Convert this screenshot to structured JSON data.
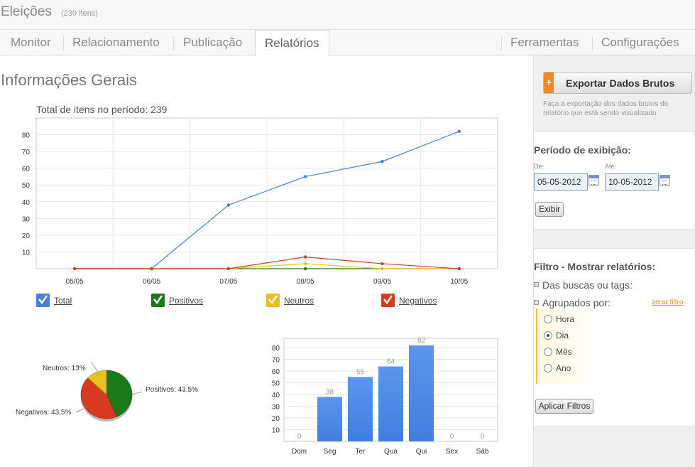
{
  "app": {
    "title": "Eleições",
    "item_count": "(239 itens)"
  },
  "tabs": [
    {
      "label": "Monitor",
      "active": false
    },
    {
      "label": "Relacionamento",
      "active": false
    },
    {
      "label": "Publicação",
      "active": false
    },
    {
      "label": "Relatórios",
      "active": true
    },
    {
      "label": "Ferramentas",
      "active": false
    },
    {
      "label": "Configurações",
      "active": false
    }
  ],
  "main": {
    "title": "Informações Gerais",
    "total_caption": "Total de itens no período: 239"
  },
  "colors": {
    "total": "#4a7fd4",
    "positivos": "#1a7a1a",
    "neutros": "#e8c020",
    "negativos": "#d83a20",
    "bars": "#3f7fe0"
  },
  "chart_data": [
    {
      "type": "line",
      "x": [
        "05/05",
        "06/05",
        "07/05",
        "08/05",
        "09/05",
        "10/05"
      ],
      "ylim": [
        0,
        90
      ],
      "yticks": [
        10,
        20,
        30,
        40,
        50,
        60,
        70,
        80
      ],
      "series": [
        {
          "name": "Total",
          "values": [
            0,
            0,
            38,
            55,
            64,
            82
          ]
        },
        {
          "name": "Positivos",
          "values": [
            0,
            0,
            0,
            0,
            0,
            0
          ]
        },
        {
          "name": "Neutros",
          "values": [
            0,
            0,
            0,
            3,
            0,
            0
          ]
        },
        {
          "name": "Negativos",
          "values": [
            0,
            0,
            0,
            7,
            3,
            0
          ]
        }
      ],
      "grid": true,
      "legend_position": "bottom"
    },
    {
      "type": "pie",
      "slices": [
        {
          "label": "Positivos: 43,5%",
          "value": 43.5
        },
        {
          "label": "Negativos: 43,5%",
          "value": 43.5
        },
        {
          "label": "Neutros: 13%",
          "value": 13
        }
      ]
    },
    {
      "type": "bar",
      "categories": [
        "Dom",
        "Seg",
        "Ter",
        "Qua",
        "Qui",
        "Sex",
        "Sáb"
      ],
      "values": [
        0,
        38,
        55,
        64,
        82,
        0,
        0
      ],
      "value_labels": [
        "0",
        "38",
        "55",
        "64",
        "82",
        "0",
        "0"
      ],
      "ylim": [
        0,
        88
      ],
      "yticks": [
        10,
        20,
        30,
        40,
        50,
        60,
        70,
        80
      ],
      "grid": true
    }
  ],
  "sidebar": {
    "export_icon": "+",
    "export_label": "Exportar Dados Brutos",
    "export_desc": "Faça a exportação dos dados brutos do relatório que está sendo visualizado",
    "period": {
      "title": "Período de exibição:",
      "from_label": "De:",
      "from_value": "05-05-2012",
      "to_label": "Até:",
      "to_value": "10-05-2012",
      "button": "Exibir"
    },
    "filter": {
      "title": "Filtro - Mostrar relatórios:",
      "option_search": "Das buscas ou tags:",
      "option_group": "Agrupados por:",
      "reset_link": "zerar filtro",
      "radios": [
        {
          "label": "Hora",
          "checked": false
        },
        {
          "label": "Dia",
          "checked": true
        },
        {
          "label": "Mês",
          "checked": false
        },
        {
          "label": "Ano",
          "checked": false
        }
      ],
      "apply_button": "Aplicar Filtros"
    }
  }
}
